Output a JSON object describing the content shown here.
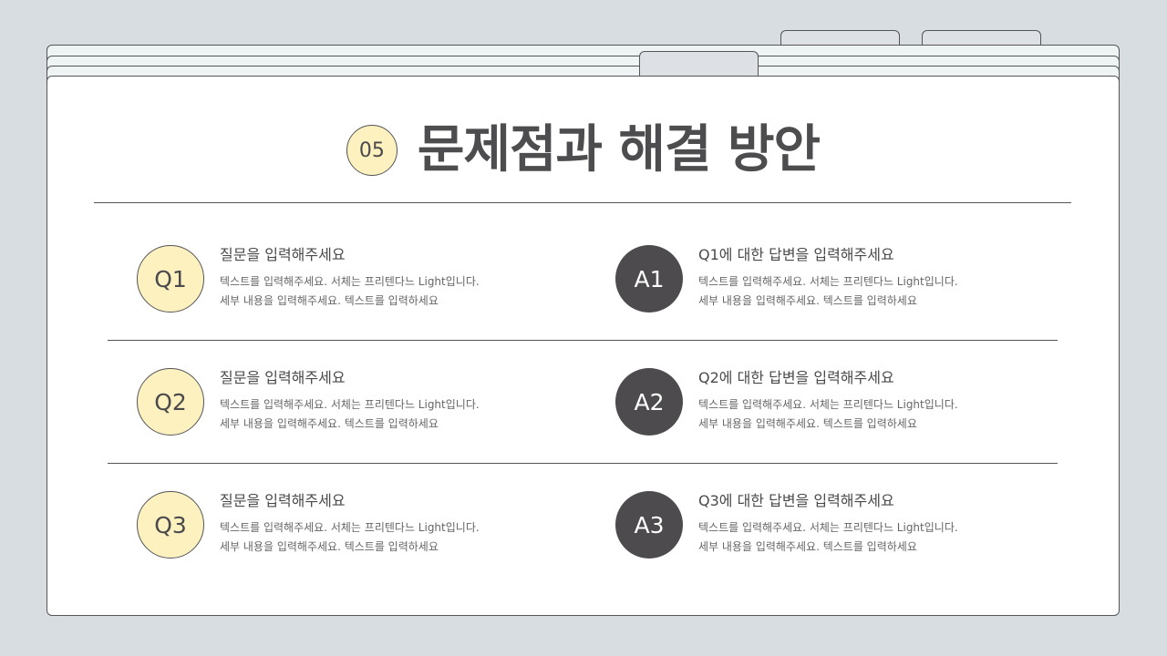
{
  "slide": {
    "number": "05",
    "title": "문제점과 해결 방안"
  },
  "rows": [
    {
      "q": {
        "badge": "Q1",
        "heading": "질문을 입력해주세요",
        "line1": "텍스트를 입력해주세요. 서체는 프리텐다느 Light입니다.",
        "line2": "세부 내용을 입력해주세요. 텍스트를 입력하세요"
      },
      "a": {
        "badge": "A1",
        "heading": "Q1에 대한 답변을 입력해주세요",
        "line1": "텍스트를 입력해주세요. 서체는 프리텐다느 Light입니다.",
        "line2": "세부 내용을 입력해주세요. 텍스트를 입력하세요"
      }
    },
    {
      "q": {
        "badge": "Q2",
        "heading": "질문을 입력해주세요",
        "line1": "텍스트를 입력해주세요. 서체는 프리텐다느 Light입니다.",
        "line2": "세부 내용을 입력해주세요. 텍스트를 입력하세요"
      },
      "a": {
        "badge": "A2",
        "heading": "Q2에 대한 답변을 입력해주세요",
        "line1": "텍스트를 입력해주세요. 서체는 프리텐다느 Light입니다.",
        "line2": "세부 내용을 입력해주세요. 텍스트를 입력하세요"
      }
    },
    {
      "q": {
        "badge": "Q3",
        "heading": "질문을 입력해주세요",
        "line1": "텍스트를 입력해주세요. 서체는 프리텐다느 Light입니다.",
        "line2": "세부 내용을 입력해주세요. 텍스트를 입력하세요"
      },
      "a": {
        "badge": "A3",
        "heading": "Q3에 대한 답변을 입력해주세요",
        "line1": "텍스트를 입력해주세요. 서체는 프리텐다느 Light입니다.",
        "line2": "세부 내용을 입력해주세요. 텍스트를 입력하세요"
      }
    }
  ],
  "colors": {
    "background": "#d8dde2",
    "question_circle": "#fdf1c0",
    "answer_circle": "#4d4b4e",
    "title_text": "#4d4d50"
  }
}
